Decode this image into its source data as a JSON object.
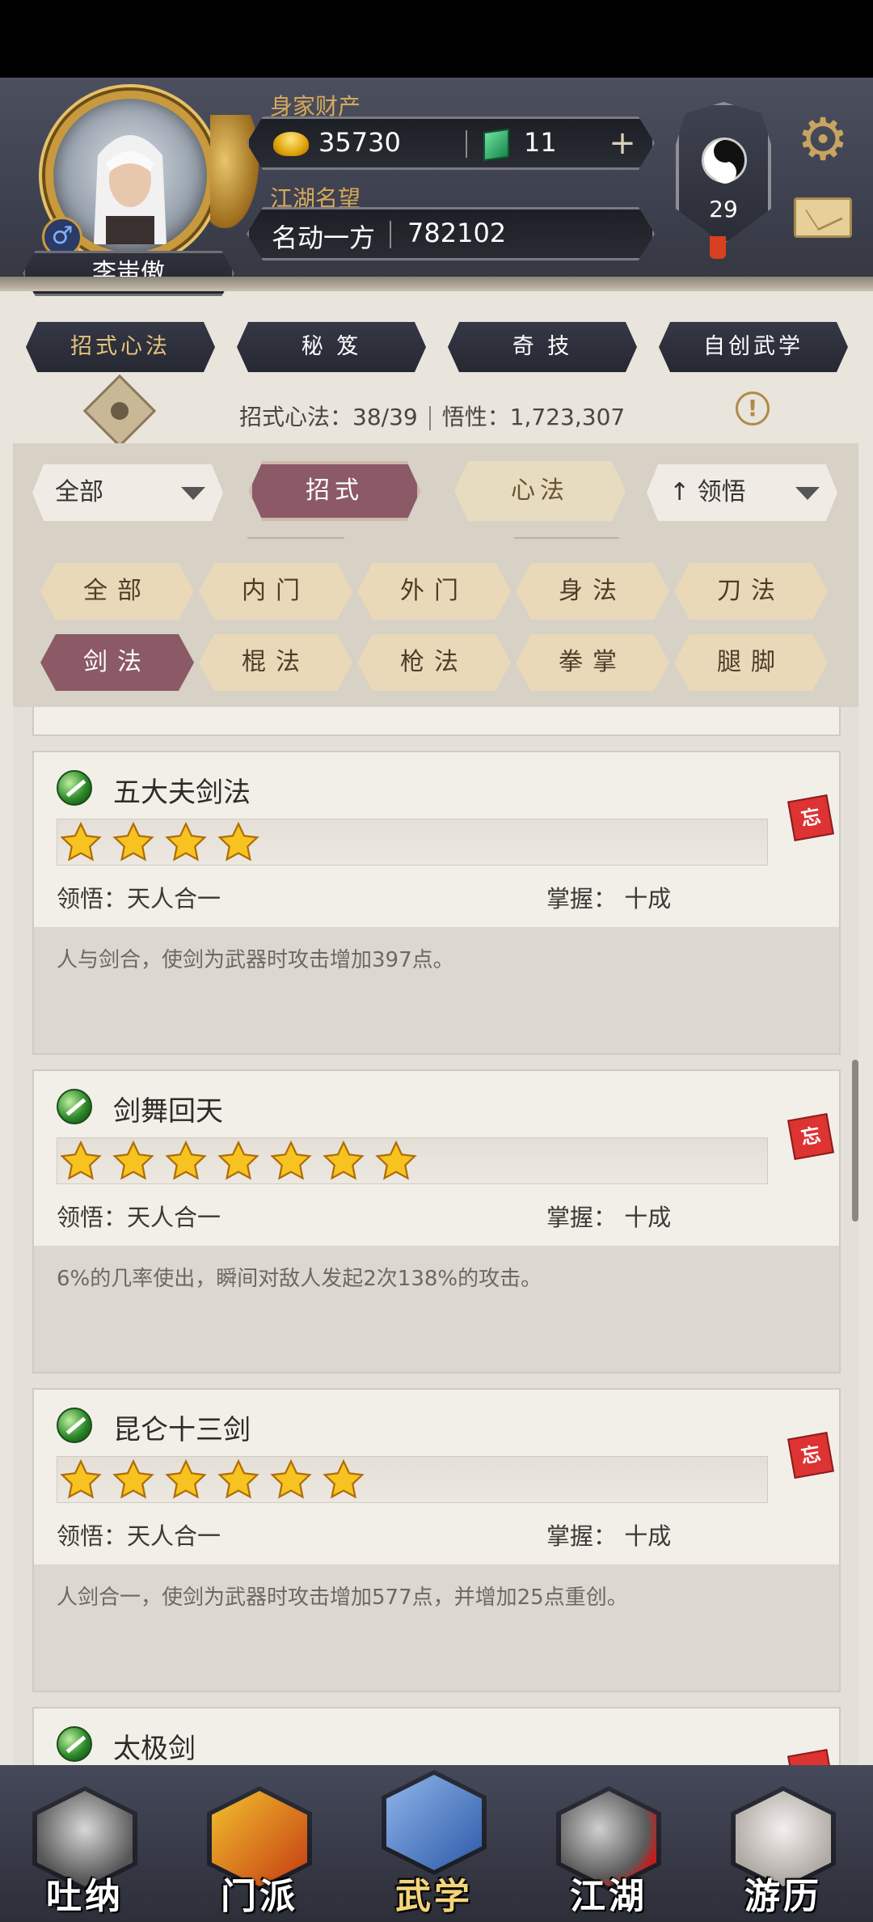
{
  "header": {
    "player_name": "李蚩傲",
    "wealth_label": "身家财产",
    "gold": "35730",
    "jade": "11",
    "plus": "+",
    "fame_label": "江湖名望",
    "fame_title": "名动一方",
    "fame_value": "782102",
    "level": "29",
    "gender": "♂"
  },
  "top_tabs": [
    "招式心法",
    "秘 笈",
    "奇 技",
    "自创武学"
  ],
  "stats": {
    "count": "招式心法：38/39",
    "insight": "悟性：1,723,307",
    "info_symbol": "!"
  },
  "filters": {
    "dropdown_all": "全部",
    "pill_moves": "招式",
    "pill_mind": "心法",
    "sort": "↑ 领悟"
  },
  "categories": {
    "row1": [
      "全部",
      "内门",
      "外门",
      "身法",
      "刀法"
    ],
    "row2": [
      "剑法",
      "棍法",
      "枪法",
      "拳掌",
      "腿脚"
    ]
  },
  "cards": [
    {
      "title": "五大夫剑法",
      "stars": 4,
      "insight": "领悟：天人合一",
      "mastery": "掌握： 十成",
      "desc": "人与剑合，使剑为武器时攻击增加397点。",
      "tag": "忘"
    },
    {
      "title": "剑舞回天",
      "stars": 7,
      "insight": "领悟：天人合一",
      "mastery": "掌握： 十成",
      "desc": "6%的几率使出，瞬间对敌人发起2次138%的攻击。",
      "tag": "忘"
    },
    {
      "title": "昆仑十三剑",
      "stars": 6,
      "insight": "领悟：天人合一",
      "mastery": "掌握： 十成",
      "desc": "人剑合一，使剑为武器时攻击增加577点，并增加25点重创。",
      "tag": "忘"
    },
    {
      "title": "太极剑",
      "stars": 0,
      "insight": "",
      "mastery": "",
      "desc": "",
      "tag": ""
    }
  ],
  "bottom_nav": [
    "吐纳",
    "门派",
    "武学",
    "江湖",
    "游历"
  ],
  "colors": {
    "active_pink": "#8b5a66",
    "gold_text": "#d7a95a",
    "header_bg": "#3d404e"
  }
}
